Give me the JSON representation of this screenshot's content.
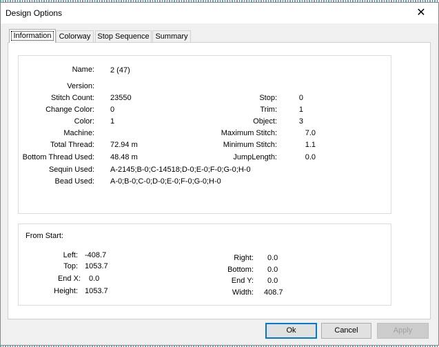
{
  "window": {
    "title": "Design Options",
    "close_glyph": "✕"
  },
  "tabs": [
    {
      "label": "Information"
    },
    {
      "label": "Colorway"
    },
    {
      "label": "Stop Sequence"
    },
    {
      "label": "Summary"
    }
  ],
  "info": {
    "name": {
      "label": "Name:",
      "value": "2 (47)"
    },
    "version": {
      "label": "Version:",
      "value": ""
    },
    "stitch_count": {
      "label": "Stitch Count:",
      "value": "23550"
    },
    "change_color": {
      "label": "Change Color:",
      "value": "0"
    },
    "color": {
      "label": "Color:",
      "value": "1"
    },
    "machine": {
      "label": "Machine:",
      "value": ""
    },
    "total_thread": {
      "label": "Total Thread:",
      "value": "72.94 m"
    },
    "bottom_thread": {
      "label": "Bottom Thread Used:",
      "value": "48.48 m"
    },
    "sequin_used": {
      "label": "Sequin Used:",
      "value": "A-2145;B-0;C-14518;D-0;E-0;F-0;G-0;H-0"
    },
    "bead_used": {
      "label": "Bead Used:",
      "value": "A-0;B-0;C-0;D-0;E-0;F-0;G-0;H-0"
    },
    "stop": {
      "label": "Stop:",
      "value": "0"
    },
    "trim": {
      "label": "Trim:",
      "value": "1"
    },
    "object": {
      "label": "Object:",
      "value": "3"
    },
    "max_stitch": {
      "label": "Maximum Stitch:",
      "value": "7.0"
    },
    "min_stitch": {
      "label": "Minimum Stitch:",
      "value": "1.1"
    },
    "jump_length": {
      "label": "JumpLength:",
      "value": "0.0"
    }
  },
  "from_start": {
    "heading": "From Start:",
    "left": {
      "label": "Left:",
      "value": "-408.7"
    },
    "top": {
      "label": "Top:",
      "value": "1053.7"
    },
    "end_x": {
      "label": "End X:",
      "value": "0.0"
    },
    "height": {
      "label": "Height:",
      "value": "1053.7"
    },
    "right": {
      "label": "Right:",
      "value": "0.0"
    },
    "bottom": {
      "label": "Bottom:",
      "value": "0.0"
    },
    "end_y": {
      "label": "End Y:",
      "value": "0.0"
    },
    "width": {
      "label": "Width:",
      "value": "408.7"
    }
  },
  "buttons": {
    "ok": "Ok",
    "cancel": "Cancel",
    "apply": "Apply"
  }
}
